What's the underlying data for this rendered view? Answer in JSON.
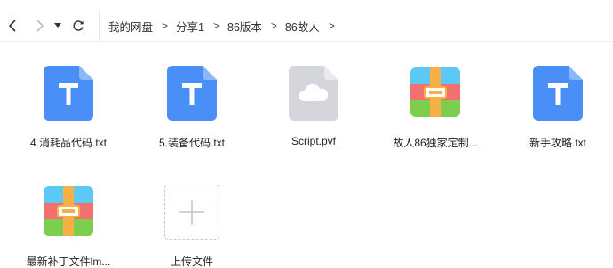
{
  "breadcrumb": {
    "items": [
      "我的网盘",
      "分享1",
      "86版本",
      "86故人"
    ],
    "separator": ">"
  },
  "files": [
    {
      "name": "4.消耗品代码.txt",
      "icon": "txt-file-icon"
    },
    {
      "name": "5.装备代码.txt",
      "icon": "txt-file-icon"
    },
    {
      "name": "Script.pvf",
      "icon": "cloud-file-icon"
    },
    {
      "name": "故人86独家定制...",
      "icon": "archive-file-icon"
    },
    {
      "name": "新手攻略.txt",
      "icon": "txt-file-icon"
    },
    {
      "name": "最新补丁文件lm...",
      "icon": "archive-file-icon"
    }
  ],
  "upload": {
    "label": "上传文件",
    "icon": "plus-icon"
  },
  "colors": {
    "txt_blue": "#4a8ef8",
    "cloud_gray": "#d4d6db",
    "archive_blue": "#5bc8f5",
    "archive_red": "#f2716f",
    "archive_green": "#7dcd4e",
    "archive_band": "#f7b046"
  }
}
